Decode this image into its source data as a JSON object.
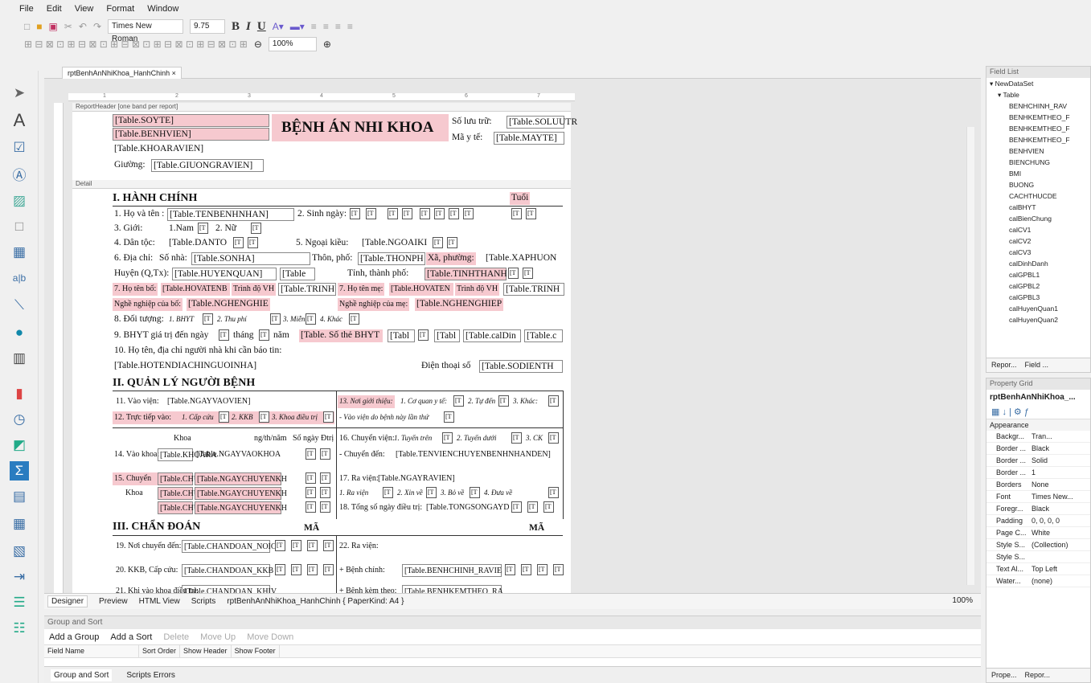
{
  "menu": [
    "File",
    "Edit",
    "View",
    "Format",
    "Window"
  ],
  "toolbar": {
    "font": "Times New Roman",
    "size": "9.75",
    "zoom": "100%",
    "bold": "B",
    "italic": "I",
    "underline": "U"
  },
  "doc_tab": "rptBenhAnNhiKhoa_HanhChinh",
  "ruler": [
    "1",
    "2",
    "3",
    "4",
    "5",
    "6",
    "7"
  ],
  "bands": {
    "header": "ReportHeader [one band per report]",
    "detail": "Detail"
  },
  "report": {
    "soyte": "[Table.SOYTE]",
    "benhvien": "[Table.BENHVIEN]",
    "khoa": "[Table.KHOARAVIEN]",
    "giuong_lbl": "Giường:",
    "giuong": "[Table.GIUONGRAVIEN]",
    "title": "BỆNH ÁN NHI KHOA",
    "soluutru_lbl": "Số lưu trữ:",
    "soluutru": "[Table.SOLUUTR",
    "mayte_lbl": "Mã y tế:",
    "mayte": "[Table.MAYTE]",
    "s1": "I. HÀNH CHÍNH",
    "tuoi": "Tuổi",
    "l1": "1. Họ và tên :",
    "hoten": "[Table.TENBENHNHAN]",
    "l2": "2. Sinh ngày:",
    "l3": "3. Giới:",
    "nam": "1.Nam",
    "nu": "2. Nữ",
    "l4": "4. Dân tộc:",
    "dantoc": "[Table.DANTO",
    "l5": "5. Ngoại kiều:",
    "ngoaikieu": "[Table.NGOAIKI",
    "l6": "6. Địa chỉ:",
    "sonha_lbl": "Số nhà:",
    "sonha": "[Table.SONHA]",
    "thon_lbl": "Thôn, phố:",
    "thon": "[Table.THONPH",
    "xa_lbl": "Xã, phường:",
    "xa": "[Table.XAPHUON",
    "huyen_lbl": "Huyện (Q,Tx):",
    "huyen": "[Table.HUYENQUAN]",
    "tbl": "[Table",
    "tinh_lbl": "Tỉnh, thành phố:",
    "tinh": "[Table.TINHTHANH",
    "l7": "7. Họ tên bố:",
    "hotenbo": "[Table.HOVATENB",
    "trinhdo": "Trình độ VH",
    "trinh": "[Table.TRINH",
    "l7b": "7. Họ tên mẹ:",
    "hotenme": "[Table.HOVATEN",
    "nghebo_lbl": "Nghề nghiệp của bố:",
    "nghebo": "[Table.NGHENGHIE",
    "ngheme_lbl": "Nghề nghiệp của mẹ:",
    "ngheme": "[Table.NGHENGHIEP",
    "l8": "8. Đối tượng:",
    "bhyt": "1. BHYT",
    "thuphi": "2. Thu phí",
    "mien": "3. Miễn",
    "khac": "4. Khác",
    "l9": "9. BHYT giá trị đến ngày",
    "thang": "tháng",
    "nam_lbl": "năm",
    "sothe": "[Table. Số thẻ BHYT",
    "tabl": "[Tabl",
    "caldin": "[Table.calDin",
    "tablc": "[Table.c",
    "l10": "10. Họ tên, địa chỉ người nhà khi cần báo tin:",
    "nguoinha": "[Table.HOTENDIACHINGUOINHA]",
    "dienthoai_lbl": "Điện thoại số",
    "dienthoai": "[Table.SODIENTH",
    "s2": "II. QUẢN LÝ NGƯỜI BỆNH",
    "l11": "11. Vào viện:",
    "vaovien": "[Table.NGAYVAOVIEN]",
    "l13": "13. Nơi giới thiệu:",
    "coquan": "1. Cơ quan y tế:",
    "tuden": "2. Tự đến",
    "khac3": "3. Khác:",
    "l12": "12. Trực tiếp vào:",
    "capcuu": "1. Cấp cứu",
    "kkb": "2. KKB",
    "khoadt": "3. Khoa điều trị",
    "lanthu": "- Vào viện do bệnh này lần thứ",
    "khoa_h": "Khoa",
    "ngay_h": "ng/th/năm",
    "songay_h": "Số ngày Đtrị",
    "l16": "16. Chuyển viện:",
    "tuyentren": "1. Tuyến trên",
    "tuyenduoi": "2. Tuyến dưới",
    "ck": "3. CK",
    "l14": "14. Vào khoa:",
    "khoara": "[Table.KHOARA",
    "ngayvaokhoa": "[Table.NGAYVAOKHOA",
    "chuyenden_lbl": "- Chuyển đến:",
    "chuyenden": "[Table.TENVIENCHUYENBENHNHANDEN]",
    "l15": "15. Chuyển",
    "khoa15": "Khoa",
    "chuyen": "[Table.CHUYEN",
    "ngaychuyen": "[Table.NGAYCHUYENKH",
    "l17": "17. Ra viện:",
    "ngayravien": "[Table.NGAYRAVIEN]",
    "ravien": "1. Ra viện",
    "xinve": "2. Xin về",
    "bove": "3. Bỏ về",
    "duave": "4. Đưa về",
    "l18": "18. Tổng số ngày điều trị:",
    "tongsongay": "[Table.TONGSONGAYD",
    "s3": "III. CHẨN ĐOÁN",
    "ma1": "MÃ",
    "ma2": "MÃ",
    "l19": "19. Nơi chuyển đến:",
    "cdnoic": "[Table.CHANDOAN_NOIC",
    "l22": "22. Ra viện:",
    "l20": "20. KKB, Cấp cứu:",
    "cdkkb": "[Table.CHANDOAN_KKB",
    "benhchinh_lbl": "+ Bệnh chính:",
    "benhchinh": "[Table.BENHCHINH_RAVIE",
    "l21": "21. Khi vào khoa điều trị:",
    "cdkhi": "[Table.CHANDOAN_KHIV",
    "benhkem_lbl": "+ Bệnh kèm theo:",
    "benhkem": "[Table.BENHKEMTHEO_RA",
    "ph": "[T"
  },
  "bottom_tabs": [
    "Designer",
    "Preview",
    "HTML View",
    "Scripts"
  ],
  "paper": "rptBenhAnNhiKhoa_HanhChinh { PaperKind: A4 }",
  "zoom_pct": "100%",
  "gs": {
    "title": "Group and Sort",
    "add_group": "Add a Group",
    "add_sort": "Add a Sort",
    "delete": "Delete",
    "move_up": "Move Up",
    "move_down": "Move Down",
    "cols": [
      "Field Name",
      "Sort Order",
      "Show Header",
      "Show Footer"
    ]
  },
  "gs_tabs": [
    "Group and Sort",
    "Scripts Errors"
  ],
  "field_list": {
    "title": "Field List",
    "dataset": "NewDataSet",
    "table": "Table",
    "items": [
      "BENHCHINH_RAV",
      "BENHKEMTHEO_F",
      "BENHKEMTHEO_F",
      "BENHKEMTHEO_F",
      "BENHVIEN",
      "BIENCHUNG",
      "BMI",
      "BUONG",
      "CACHTHUCDE",
      "calBHYT",
      "calBienChung",
      "calCV1",
      "calCV2",
      "calCV3",
      "calDinhDanh",
      "calGPBL1",
      "calGPBL2",
      "calGPBL3",
      "calHuyenQuan1",
      "calHuyenQuan2"
    ],
    "tabs": [
      "Repor...",
      "Field ..."
    ]
  },
  "prop_grid": {
    "title": "Property Grid",
    "object": "rptBenhAnNhiKhoa_...",
    "category": "Appearance",
    "rows": [
      [
        "Backgr...",
        "Tran..."
      ],
      [
        "Border ...",
        "Black"
      ],
      [
        "Border ...",
        "Solid"
      ],
      [
        "Border ...",
        "1"
      ],
      [
        "Borders",
        "None"
      ],
      [
        "Font",
        "Times New..."
      ],
      [
        "Foregr...",
        "Black"
      ],
      [
        "Padding",
        "0, 0, 0, 0"
      ],
      [
        "Page C...",
        "White"
      ],
      [
        "Style S...",
        "(Collection)"
      ],
      [
        "Style S...",
        ""
      ],
      [
        "Text Al...",
        "Top Left"
      ],
      [
        "Water...",
        "(none)"
      ]
    ],
    "tabs": [
      "Prope...",
      "Repor..."
    ]
  }
}
